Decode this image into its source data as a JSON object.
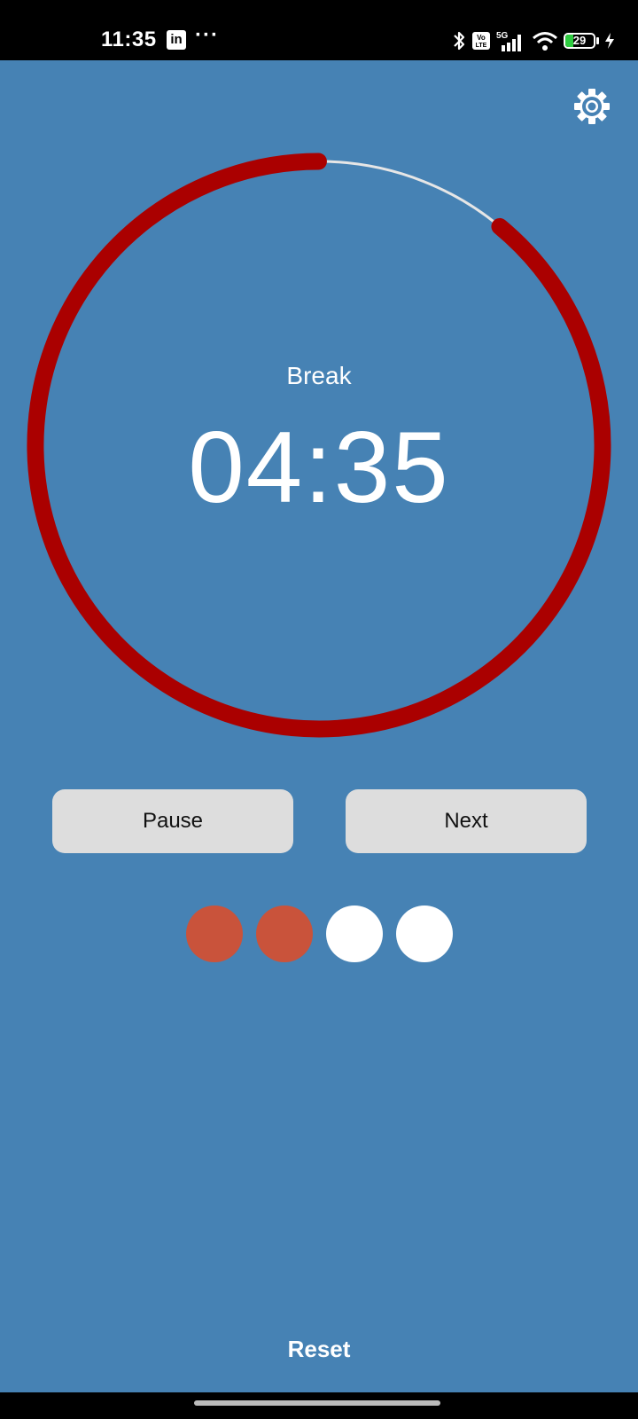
{
  "status_bar": {
    "time": "11:35",
    "notification_app": "in",
    "more": "···",
    "battery_level": "29"
  },
  "timer": {
    "phase": "Break",
    "time": "04:35",
    "progress_fraction": 0.89,
    "ring_color": "#AA0000",
    "track_color": "#E6E6E6"
  },
  "controls": {
    "pause_label": "Pause",
    "next_label": "Next",
    "reset_label": "Reset"
  },
  "sessions": {
    "completed": 2,
    "total": 4,
    "completed_color": "#C9533B",
    "pending_color": "#FFFFFF"
  },
  "colors": {
    "background": "#4682B4",
    "button_bg": "#DDDDDD"
  },
  "icons": {
    "settings": "gear-icon"
  }
}
